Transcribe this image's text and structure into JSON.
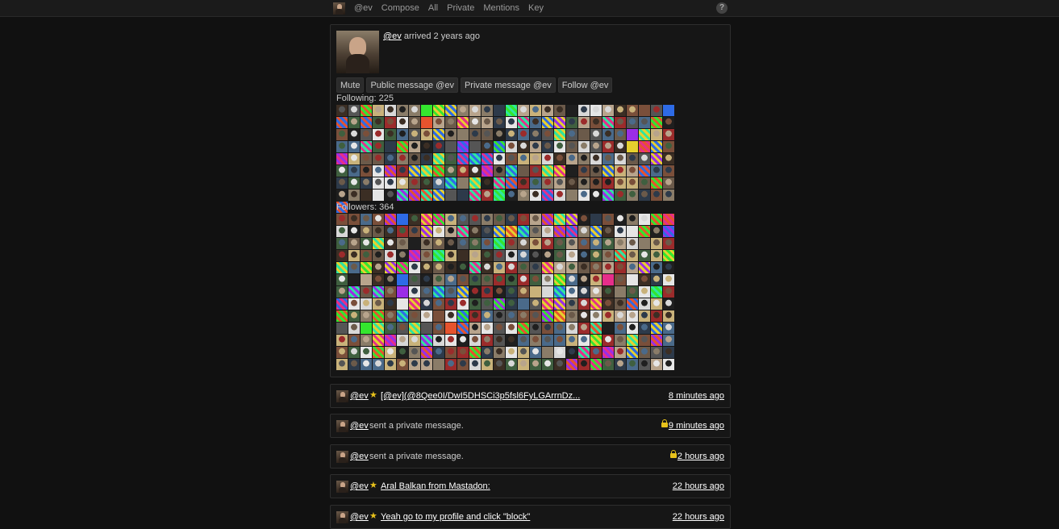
{
  "nav": {
    "items": [
      "@ev",
      "Compose",
      "All",
      "Private",
      "Mentions",
      "Key"
    ],
    "help": "?"
  },
  "profile": {
    "handle": "@ev",
    "arrived": "arrived 2 years ago",
    "actions": [
      "Mute",
      "Public message @ev",
      "Private message @ev",
      "Follow @ev"
    ],
    "following_label": "Following: 225",
    "followers_label": "Followers: 364",
    "following_count": 225,
    "followers_count": 364
  },
  "timeline": [
    {
      "who": "@ev",
      "starred": true,
      "text": "[@ev](@8Qee0I/DwI5DHSCi3p5fsl6FyLGArrnDz...",
      "link": true,
      "private": false,
      "time": "8 minutes ago"
    },
    {
      "who": "@ev",
      "starred": false,
      "text": "sent a private message.",
      "link": false,
      "private": true,
      "time": "9 minutes ago"
    },
    {
      "who": "@ev",
      "starred": false,
      "text": "sent a private message.",
      "link": false,
      "private": true,
      "time": "2 hours ago"
    },
    {
      "who": "@ev",
      "starred": true,
      "text": "Aral Balkan from Mastadon:",
      "link": true,
      "private": false,
      "time": "22 hours ago"
    },
    {
      "who": "@ev",
      "starred": true,
      "text": "Yeah go to my profile and click \"block\"",
      "link": true,
      "private": false,
      "time": "22 hours ago"
    }
  ],
  "colors": {
    "background": "#111111",
    "panel": "#161616",
    "star": "#e8c21b",
    "link": "#ffffff"
  },
  "icons": [
    "user-avatar",
    "star-icon",
    "lock-icon",
    "help-icon"
  ]
}
